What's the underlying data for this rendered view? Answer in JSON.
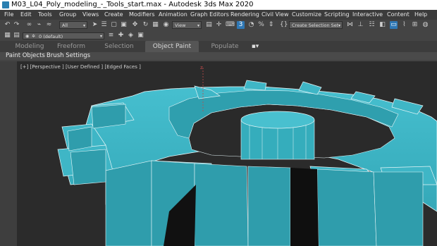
{
  "window": {
    "title": "M03_L04_Poly_modeling_-_Tools_start.max - Autodesk 3ds Max 2020"
  },
  "menu": [
    "File",
    "Edit",
    "Tools",
    "Group",
    "Views",
    "Create",
    "Modifiers",
    "Animation",
    "Graph Editors",
    "Rendering",
    "Civil View",
    "Customize",
    "Scripting",
    "Interactive",
    "Content",
    "Help"
  ],
  "toolbar": {
    "selection_filter": "All",
    "reference_coord": "View",
    "snap_value": "3",
    "selection_set": "Create Selection Set"
  },
  "layer": {
    "current": "0 (default)"
  },
  "ribbon": {
    "tabs": [
      "Modeling",
      "Freeform",
      "Selection",
      "Object Paint",
      "Populate"
    ],
    "active_tab": "Object Paint",
    "panel_items": [
      "Paint Objects",
      "Brush Settings"
    ]
  },
  "viewport": {
    "label": "[+] [Perspective ] [User Defined ] [Edged Faces ]",
    "object_color": "#34a8b8",
    "axis_label": "z"
  },
  "colors": {
    "accent": "#2f78b5",
    "background": "#2b2b2b"
  }
}
